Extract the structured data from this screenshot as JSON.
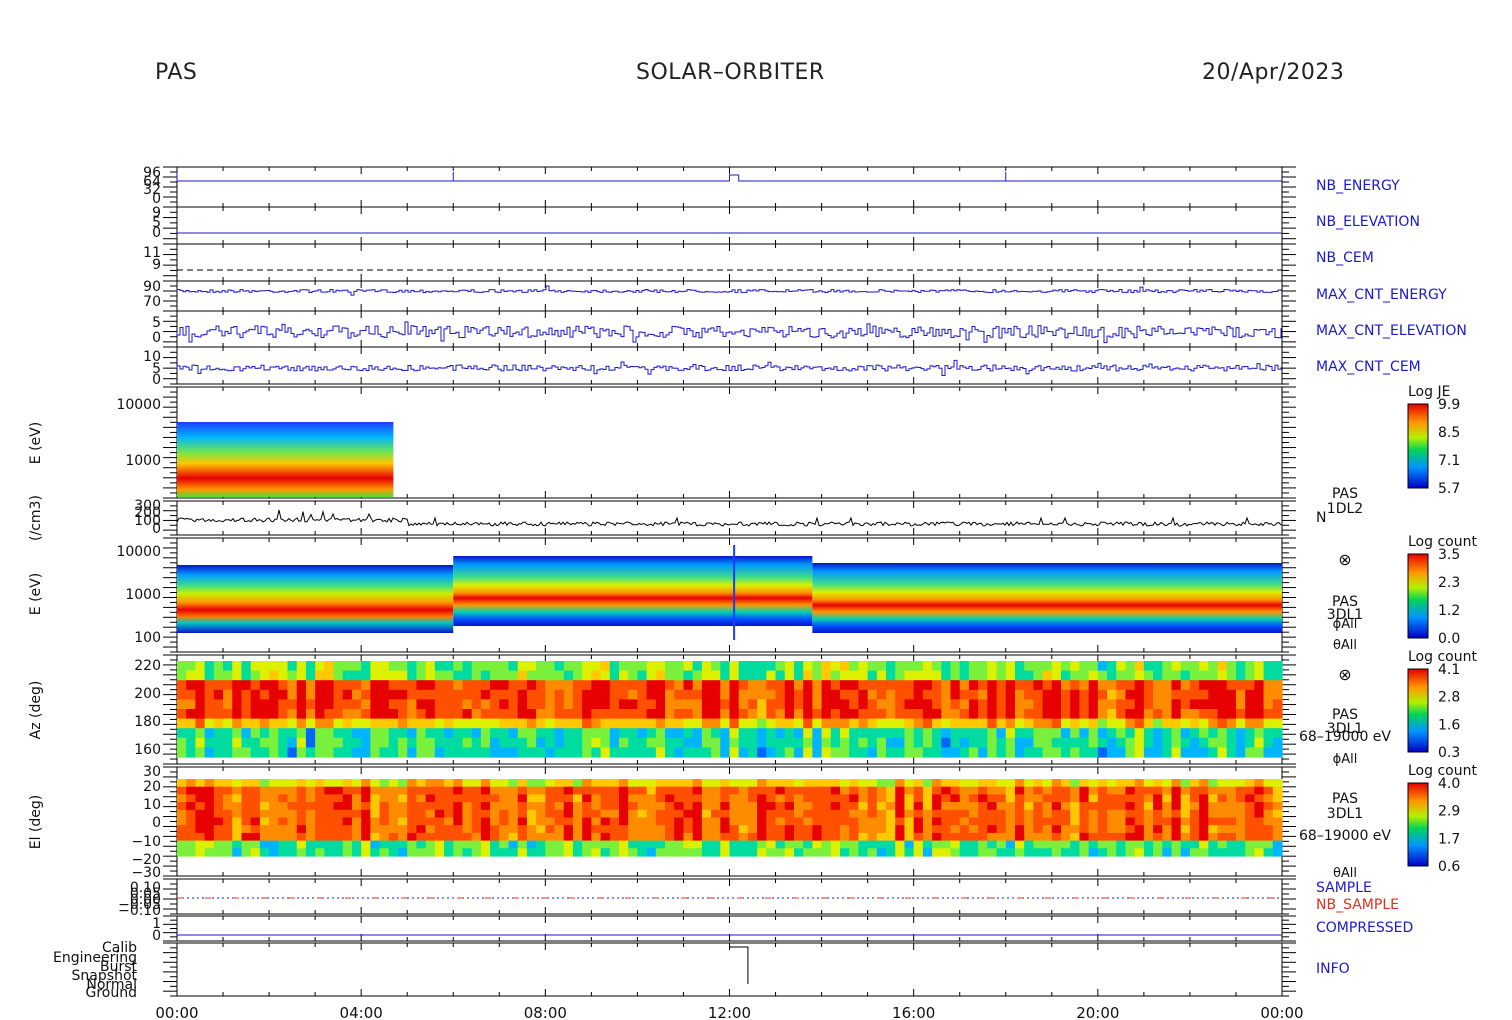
{
  "header": {
    "instrument": "PAS",
    "mission": "SOLAR–ORBITER",
    "date": "20/Apr/2023"
  },
  "colors": {
    "blue": "#1a1acd",
    "red": "#e0301e",
    "black": "#000000"
  },
  "chart_data": {
    "type": "multi-panel time series and spectrograms",
    "x_axis": {
      "ticks": [
        "00:00",
        "04:00",
        "08:00",
        "12:00",
        "16:00",
        "20:00",
        "00:00"
      ],
      "range_hours": [
        0,
        24
      ]
    },
    "panels": [
      {
        "id": "nb_energy",
        "type": "line",
        "label": "NB_ENERGY",
        "color": "#1a1acd",
        "y_ticks": [
          "96",
          "64",
          "32",
          "0"
        ]
      },
      {
        "id": "nb_elevation",
        "type": "line",
        "label": "NB_ELEVATION",
        "color": "#1a1acd",
        "y_ticks": [
          "9",
          "5",
          "0"
        ]
      },
      {
        "id": "nb_cem",
        "type": "line",
        "label": "NB_CEM",
        "color": "#1a1acd",
        "y_ticks": [
          "11",
          "9"
        ]
      },
      {
        "id": "max_cnt_energy",
        "type": "line",
        "label": "MAX_CNT_ENERGY",
        "color": "#1a1acd",
        "y_ticks": [
          "90",
          "70"
        ]
      },
      {
        "id": "max_cnt_elevation",
        "type": "line",
        "label": "MAX_CNT_ELEVATION",
        "color": "#1a1acd",
        "y_ticks": [
          "5",
          "0"
        ]
      },
      {
        "id": "max_cnt_cem",
        "type": "line",
        "label": "MAX_CNT_CEM",
        "color": "#1a1acd",
        "y_ticks": [
          "10",
          "5",
          "0"
        ]
      },
      {
        "id": "je_spec",
        "type": "heatmap",
        "ylabel": "E (eV)",
        "y_ticks": [
          "10000",
          "1000"
        ],
        "colorbar": {
          "title": "Log JE",
          "ticks": [
            "9.9",
            "8.5",
            "7.1",
            "5.7"
          ]
        },
        "coverage_hours": [
          0,
          4.7
        ]
      },
      {
        "id": "density",
        "type": "line",
        "ylabel": "(/cm3)",
        "y_ticks": [
          "300",
          "200",
          "100",
          "0"
        ],
        "color": "#000000",
        "labels": [
          "PAS",
          "1DL2",
          "N"
        ]
      },
      {
        "id": "e_spec",
        "type": "heatmap",
        "ylabel": "E (eV)",
        "y_ticks": [
          "10000",
          "1000",
          "100"
        ],
        "colorbar": {
          "title": "Log count",
          "ticks": [
            "3.5",
            "2.3",
            "1.2",
            "0.0"
          ]
        },
        "labels": [
          "PAS",
          "3DL1",
          "ϕAll",
          "θAll"
        ]
      },
      {
        "id": "az_spec",
        "type": "heatmap",
        "ylabel": "Az (deg)",
        "y_ticks": [
          "220",
          "200",
          "180",
          "160"
        ],
        "colorbar": {
          "title": "Log count",
          "ticks": [
            "4.1",
            "2.8",
            "1.6",
            "0.3"
          ]
        },
        "labels": [
          "PAS",
          "3DL1",
          "68–19000 eV",
          "ϕAll"
        ]
      },
      {
        "id": "el_spec",
        "type": "heatmap",
        "ylabel": "El (deg)",
        "y_ticks": [
          "30",
          "20",
          "10",
          "0",
          "−10",
          "−20",
          "−30"
        ],
        "colorbar": {
          "title": "Log count",
          "ticks": [
            "4.0",
            "2.9",
            "1.7",
            "0.6"
          ]
        },
        "labels": [
          "PAS",
          "3DL1",
          "68–19000 eV",
          "θAll"
        ]
      },
      {
        "id": "sample",
        "type": "line",
        "y_ticks": [
          "0.10",
          "0.05",
          "0.00",
          "−0.05",
          "−0.10"
        ],
        "labels": [
          "SAMPLE",
          "NB_SAMPLE"
        ],
        "label_colors": [
          "#1a1acd",
          "#e0301e"
        ]
      },
      {
        "id": "compressed",
        "type": "line",
        "label": "COMPRESSED",
        "color": "#1a1acd",
        "y_ticks": [
          "1",
          "0"
        ]
      },
      {
        "id": "info",
        "type": "line",
        "label": "INFO",
        "color": "#1a1acd",
        "y_ticks": [
          "Calib",
          "Engineering",
          "Burst",
          "Snapshot",
          "Normal",
          "Ground"
        ]
      }
    ]
  }
}
